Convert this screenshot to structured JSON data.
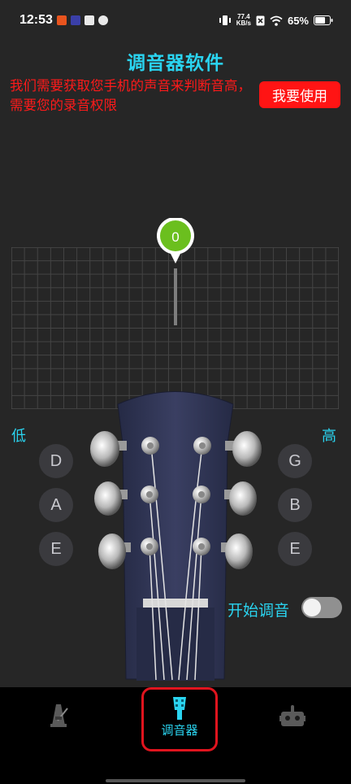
{
  "status_bar": {
    "time": "12:53",
    "net_speed_value": "77.4",
    "net_speed_unit": "KB/s",
    "battery": "65%"
  },
  "app": {
    "title": "调音器软件",
    "permission_message": "我们需要获取您手机的声音来判断音高，需要您的录音权限",
    "use_button": "我要使用"
  },
  "tuner": {
    "pitch_value": "0",
    "low_label": "低",
    "high_label": "高",
    "left_strings": [
      "D",
      "A",
      "E"
    ],
    "right_strings": [
      "G",
      "B",
      "E"
    ],
    "start_tuning_label": "开始调音",
    "start_tuning_on": false
  },
  "bottom_nav": {
    "items": [
      {
        "icon": "metronome-icon",
        "label": ""
      },
      {
        "icon": "tuning-peg-icon",
        "label": "调音器"
      },
      {
        "icon": "robot-icon",
        "label": ""
      }
    ],
    "active_index": 1
  },
  "colors": {
    "accent": "#2ad4f0",
    "alert": "#ff1414",
    "indicator": "#6bbf1e",
    "headstock": "#2e3250"
  }
}
